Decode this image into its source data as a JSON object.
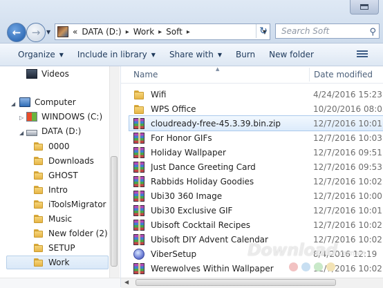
{
  "address": {
    "history_symbol": "«",
    "crumbs": [
      "DATA (D:)",
      "Work",
      "Soft"
    ],
    "search_placeholder": "Search Soft"
  },
  "toolbar": {
    "organize": "Organize",
    "include_in_library": "Include in library",
    "share_with": "Share with",
    "burn": "Burn",
    "new_folder": "New folder"
  },
  "nav": {
    "videos": "Videos",
    "computer": "Computer",
    "drive_c": "WINDOWS (C:)",
    "drive_d": "DATA (D:)",
    "folders": [
      "0000",
      "Downloads",
      "GHOST",
      "Intro",
      "iToolsMigrator",
      "Music",
      "New folder (2)",
      "SETUP",
      "Work"
    ]
  },
  "columns": {
    "name": "Name",
    "date": "Date modified"
  },
  "files": [
    {
      "name": "Wifi",
      "date": "4/24/2016 15:23",
      "type": "folder"
    },
    {
      "name": "WPS Office",
      "date": "10/20/2016 08:05",
      "type": "folder"
    },
    {
      "name": "cloudready-free-45.3.39.bin.zip",
      "date": "12/7/2016 10:01",
      "type": "archive",
      "selected": true
    },
    {
      "name": "For Honor GIFs",
      "date": "12/7/2016 10:03",
      "type": "archive"
    },
    {
      "name": "Holiday Wallpaper",
      "date": "12/7/2016 09:51",
      "type": "archive"
    },
    {
      "name": "Just Dance Greeting Card",
      "date": "12/7/2016 09:53",
      "type": "archive"
    },
    {
      "name": "Rabbids Holiday Goodies",
      "date": "12/7/2016 10:02",
      "type": "archive"
    },
    {
      "name": "Ubi30 360 Image",
      "date": "12/7/2016 10:00",
      "type": "archive"
    },
    {
      "name": "Ubi30 Exclusive GIF",
      "date": "12/7/2016 10:01",
      "type": "archive"
    },
    {
      "name": "Ubisoft Cocktail Recipes",
      "date": "12/7/2016 10:02",
      "type": "archive"
    },
    {
      "name": "Ubisoft DIY Advent Calendar",
      "date": "12/7/2016 10:02",
      "type": "archive"
    },
    {
      "name": "ViberSetup",
      "date": "8/4/2016 12:19",
      "type": "setup"
    },
    {
      "name": "Werewolves Within Wallpaper",
      "date": "12/7/2016 10:02",
      "type": "archive"
    }
  ],
  "watermark": {
    "text": "Download",
    "suffix": ".com.vn"
  },
  "colors": {
    "selection": "#dcebfb",
    "toolbar_text": "#1e395b",
    "date_text": "#6d6d6d"
  }
}
